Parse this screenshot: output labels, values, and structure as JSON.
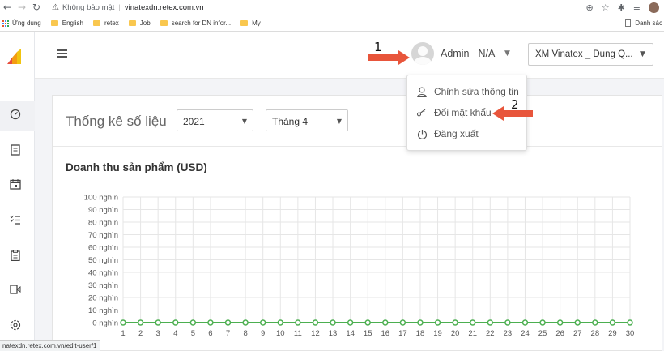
{
  "browser": {
    "security_label": "Không bảo mật",
    "url": "vinatexdn.retex.com.vn",
    "bookmarks": [
      "Ứng dụng",
      "English",
      "retex",
      "Job",
      "search for DN infor...",
      "My"
    ],
    "bookmarks_right": "Danh sác",
    "status_url": "natexdn.retex.com.vn/edit-user/1"
  },
  "header": {
    "user_name": "Admin - N/A",
    "company": "XM Vinatex _ Dung Q..."
  },
  "user_menu": {
    "items": [
      "Chỉnh sửa thông tin",
      "Đổi mật khẩu",
      "Đăng xuất"
    ]
  },
  "annotations": {
    "label_1": "1",
    "label_2": "2",
    "color": "#e8553b"
  },
  "dashboard": {
    "title": "Thống kê số liệu",
    "year": "2021",
    "month": "Tháng 4"
  },
  "chart_data": {
    "type": "line",
    "title": "Doanh thu sản phẩm (USD)",
    "x": [
      1,
      2,
      3,
      4,
      5,
      6,
      7,
      8,
      9,
      10,
      11,
      12,
      13,
      14,
      15,
      16,
      17,
      18,
      19,
      20,
      21,
      22,
      23,
      24,
      25,
      26,
      27,
      28,
      29,
      30
    ],
    "ytick_labels": [
      "0 nghìn",
      "10 nghìn",
      "20 nghìn",
      "30 nghìn",
      "40 nghìn",
      "50 nghìn",
      "60 nghìn",
      "70 nghìn",
      "80 nghìn",
      "90 nghìn",
      "100 nghìn"
    ],
    "ylim": [
      0,
      100000
    ],
    "series": [
      {
        "color": "#4caf50",
        "values": [
          0,
          0,
          0,
          0,
          0,
          0,
          0,
          0,
          0,
          0,
          0,
          0,
          0,
          0,
          0,
          0,
          0,
          0,
          0,
          0,
          0,
          0,
          0,
          0,
          0,
          0,
          0,
          0,
          0,
          0
        ]
      }
    ],
    "grid": true
  }
}
